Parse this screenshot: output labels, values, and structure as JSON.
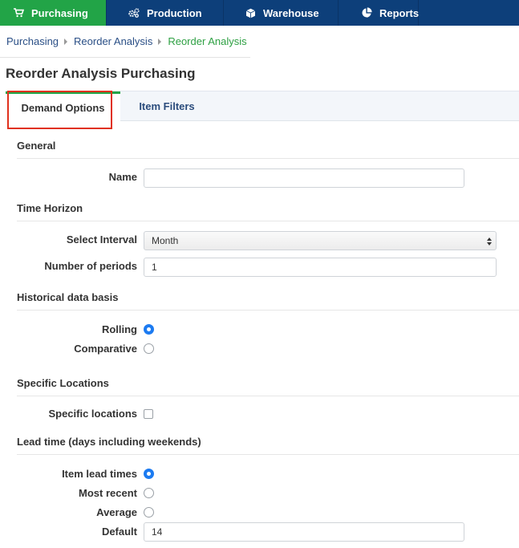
{
  "nav": {
    "items": [
      {
        "label": "Purchasing",
        "icon": "cart-icon"
      },
      {
        "label": "Production",
        "icon": "gears-icon"
      },
      {
        "label": "Warehouse",
        "icon": "box-icon"
      },
      {
        "label": "Reports",
        "icon": "pie-chart-icon"
      }
    ],
    "active": "Purchasing",
    "colors": {
      "bar": "#0d3f7a",
      "active": "#22a447"
    }
  },
  "breadcrumb": [
    "Purchasing",
    "Reorder Analysis",
    "Reorder Analysis"
  ],
  "page_title": "Reorder Analysis Purchasing",
  "tabs": [
    {
      "label": "Demand Options",
      "selected": true
    },
    {
      "label": "Item Filters",
      "selected": false
    }
  ],
  "general": {
    "title": "General",
    "name_label": "Name",
    "name_value": ""
  },
  "time_horizon": {
    "title": "Time Horizon",
    "interval_label": "Select Interval",
    "interval_value": "Month",
    "periods_label": "Number of periods",
    "periods_value": "1"
  },
  "historical": {
    "title": "Historical data basis",
    "options": [
      {
        "label": "Rolling",
        "checked": true
      },
      {
        "label": "Comparative",
        "checked": false
      }
    ]
  },
  "locations": {
    "title": "Specific Locations",
    "checkbox_label": "Specific locations",
    "checked": false
  },
  "lead_time": {
    "title": "Lead time (days including weekends)",
    "options": [
      {
        "label": "Item lead times",
        "checked": true
      },
      {
        "label": "Most recent",
        "checked": false
      },
      {
        "label": "Average",
        "checked": false
      }
    ],
    "default_label": "Default",
    "default_value": "14"
  }
}
